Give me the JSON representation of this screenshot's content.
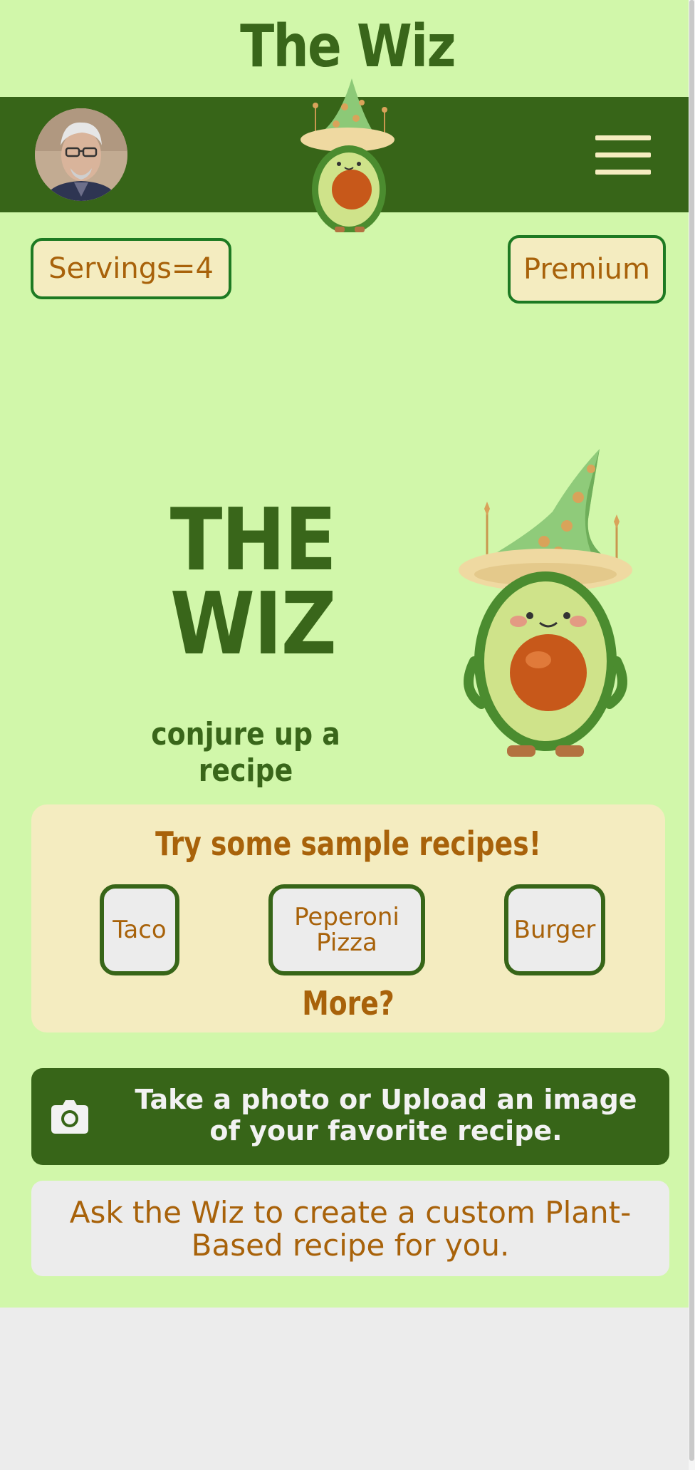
{
  "app": {
    "title": "The Wiz"
  },
  "header": {
    "menu_icon": "hamburger-menu-icon",
    "avatar_alt": "user avatar",
    "mascot_icon": "avocado-wizard-mascot"
  },
  "controls": {
    "servings_label": "Servings=4",
    "premium_label": "Premium"
  },
  "hero": {
    "title_line1": "THE",
    "title_line2": "WIZ",
    "tagline": "conjure up a recipe"
  },
  "samples": {
    "heading": "Try some sample recipes!",
    "items": [
      {
        "label": "Taco"
      },
      {
        "label": "Peperoni Pizza"
      },
      {
        "label": "Burger"
      }
    ],
    "more_label": "More?"
  },
  "photo_action": {
    "icon": "camera-icon",
    "label": "Take a photo or Upload an image of your favorite recipe."
  },
  "custom_action": {
    "label": "Ask the Wiz to create a custom Plant-Based recipe for you."
  },
  "colors": {
    "background": "#d1f7aa",
    "primary_green": "#376518",
    "accent_orange": "#a8620a",
    "cream": "#f4ecc0"
  }
}
